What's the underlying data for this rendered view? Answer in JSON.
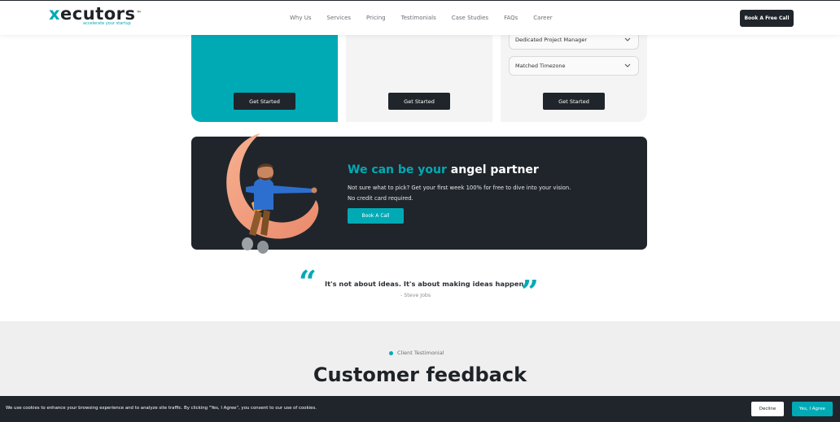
{
  "header": {
    "logo": {
      "text_x": "x",
      "text_rest": "ecutors",
      "tm": "™",
      "tagline": "accelerate your startup"
    },
    "nav": [
      {
        "label": "Why Us"
      },
      {
        "label": "Services"
      },
      {
        "label": "Pricing"
      },
      {
        "label": "Testimonials"
      },
      {
        "label": "Case Studies"
      },
      {
        "label": "FAQs"
      },
      {
        "label": "Career"
      }
    ],
    "cta_label": "Book A Free Call"
  },
  "pricing": {
    "cards": [
      {
        "button_label": "Get Started"
      },
      {
        "button_label": "Get Started"
      },
      {
        "button_label": "Get Started"
      }
    ],
    "dropdowns": [
      {
        "label": "Dedicated Project Manager"
      },
      {
        "label": "Matched Timezone"
      }
    ]
  },
  "banner": {
    "title_accent": "We can be your ",
    "title_rest": "angel partner",
    "text_line1": "Not sure what to pick? Get your first week 100% for free to dive into your vision.",
    "text_line2": "No credit card required.",
    "button_label": "Book A Call"
  },
  "quote": {
    "open_mark": "“",
    "close_mark": "”",
    "text": "It's not about ideas. It's about making ideas happen.",
    "author": "- Steve Jobs"
  },
  "testimonial": {
    "label": "Client Testimonial",
    "title": "Customer feedback"
  },
  "cookie": {
    "text": "We use cookies to enhance your browsing experience and to analyze site traffic. By clicking \"Yes, I Agree\", you consent to our use of cookies.",
    "decline_label": "Decline",
    "accept_label": "Yes, I Agree"
  },
  "colors": {
    "brand_teal": "#00aab5",
    "dark": "#20252b",
    "light_card": "#f4f4f5"
  }
}
